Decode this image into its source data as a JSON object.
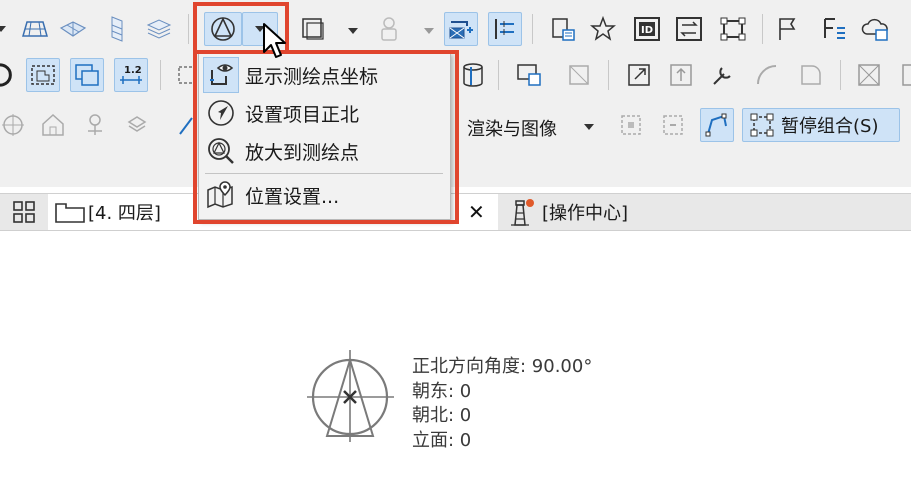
{
  "toolbar": {
    "render_menu_label": "渲染与图像",
    "suspend_groups_label": "暂停组合(S)"
  },
  "survey_menu": {
    "items": [
      {
        "label": "显示测绘点坐标",
        "icon": "survey-point-eye-icon"
      },
      {
        "label": "设置项目正北",
        "icon": "compass-north-icon"
      },
      {
        "label": "放大到测绘点",
        "icon": "zoom-survey-point-icon"
      },
      {
        "label": "位置设置...",
        "icon": "map-location-icon"
      }
    ]
  },
  "tabs": [
    {
      "label": "[4. 四层]",
      "icon": "floor-plan-icon"
    },
    {
      "label": "[操作中心]",
      "icon": "lighthouse-icon"
    }
  ],
  "survey_point": {
    "north_angle": "正北方向角度: 90.00°",
    "easting": "朝东: 0",
    "northing": "朝北: 0",
    "elevation": "立面: 0"
  },
  "colors": {
    "highlight": "#e0452e",
    "active_button": "#cfe3f7",
    "icon_blue": "#1f6fc0"
  }
}
